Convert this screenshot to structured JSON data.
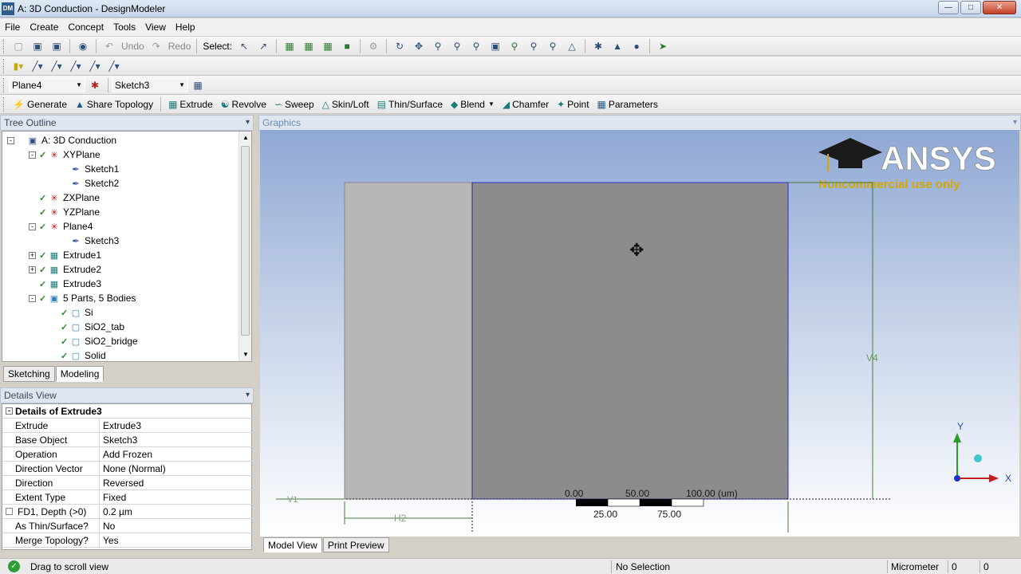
{
  "window": {
    "title": "A: 3D Conduction - DesignModeler",
    "app_icon": "DM",
    "buttons": [
      "minimize-icon",
      "maximize-icon",
      "close-icon"
    ]
  },
  "menu": [
    "File",
    "Create",
    "Concept",
    "Tools",
    "View",
    "Help"
  ],
  "toolbar1": {
    "undo_label": "Undo",
    "redo_label": "Redo",
    "select_label": "Select:"
  },
  "toolbar3": {
    "plane_value": "Plane4",
    "sketch_value": "Sketch3"
  },
  "toolbar4": {
    "items": [
      "Generate",
      "Share Topology",
      "Extrude",
      "Revolve",
      "Sweep",
      "Skin/Loft",
      "Thin/Surface",
      "Blend",
      "Chamfer",
      "Point",
      "Parameters"
    ]
  },
  "tree_outline": {
    "title": "Tree Outline",
    "items": [
      {
        "label": "A: 3D Conduction",
        "icon": "root-icon",
        "depth": 0,
        "expander": "-",
        "check": false
      },
      {
        "label": "XYPlane",
        "icon": "plane-icon",
        "depth": 1,
        "expander": "-",
        "check": true
      },
      {
        "label": "Sketch1",
        "icon": "sketch-icon",
        "depth": 2,
        "expander": "",
        "check": false
      },
      {
        "label": "Sketch2",
        "icon": "sketch-icon",
        "depth": 2,
        "expander": "",
        "check": false
      },
      {
        "label": "ZXPlane",
        "icon": "plane-icon",
        "depth": 1,
        "expander": "",
        "check": true
      },
      {
        "label": "YZPlane",
        "icon": "plane-icon",
        "depth": 1,
        "expander": "",
        "check": true
      },
      {
        "label": "Plane4",
        "icon": "plane-icon",
        "depth": 1,
        "expander": "-",
        "check": true
      },
      {
        "label": "Sketch3",
        "icon": "sketch-icon",
        "depth": 2,
        "expander": "",
        "check": false
      },
      {
        "label": "Extrude1",
        "icon": "extrude-icon",
        "depth": 1,
        "expander": "+",
        "check": true
      },
      {
        "label": "Extrude2",
        "icon": "extrude-icon",
        "depth": 1,
        "expander": "+",
        "check": true
      },
      {
        "label": "Extrude3",
        "icon": "extrude-icon",
        "depth": 1,
        "expander": "",
        "check": true
      },
      {
        "label": "5 Parts, 5 Bodies",
        "icon": "parts-icon",
        "depth": 1,
        "expander": "-",
        "check": true
      },
      {
        "label": "Si",
        "icon": "body-icon",
        "depth": 2,
        "expander": "",
        "check": true
      },
      {
        "label": "SiO2_tab",
        "icon": "body-icon",
        "depth": 2,
        "expander": "",
        "check": true
      },
      {
        "label": "SiO2_bridge",
        "icon": "body-icon",
        "depth": 2,
        "expander": "",
        "check": true
      },
      {
        "label": "Solid",
        "icon": "body-icon",
        "depth": 2,
        "expander": "",
        "check": true
      }
    ]
  },
  "left_tabs": [
    "Sketching",
    "Modeling"
  ],
  "details_view": {
    "title": "Details View",
    "header": "Details of Extrude3",
    "rows": [
      {
        "label": "Extrude",
        "value": "Extrude3"
      },
      {
        "label": "Base Object",
        "value": "Sketch3"
      },
      {
        "label": "Operation",
        "value": "Add Frozen"
      },
      {
        "label": "Direction Vector",
        "value": "None (Normal)"
      },
      {
        "label": "Direction",
        "value": "Reversed"
      },
      {
        "label": "Extent Type",
        "value": "Fixed"
      },
      {
        "label": "FD1, Depth (>0)",
        "value": "0.2 µm"
      },
      {
        "label": "As Thin/Surface?",
        "value": "No"
      },
      {
        "label": "Merge Topology?",
        "value": "Yes"
      }
    ]
  },
  "graphics": {
    "title": "Graphics",
    "logo_text": "ANSYS",
    "logo_sub": "Noncommercial use only",
    "dim_v4": "V4",
    "dim_h2": "H2",
    "dim_v1": "V1",
    "scale_top": [
      "0.00",
      "50.00",
      "100.00 (um)"
    ],
    "scale_bottom": [
      "25.00",
      "75.00"
    ],
    "axis_x": "X",
    "axis_y": "Y",
    "colors": {
      "body_light": "#b7b7b7",
      "body_dark": "#8a8a8a",
      "edge": "#2b2bd6",
      "dimension": "#4a7a3a"
    }
  },
  "graphics_tabs": [
    "Model View",
    "Print Preview"
  ],
  "status": {
    "message": "Drag to scroll view",
    "selection": "No Selection",
    "units": "Micrometer",
    "coord1": "0",
    "coord2": "0"
  }
}
